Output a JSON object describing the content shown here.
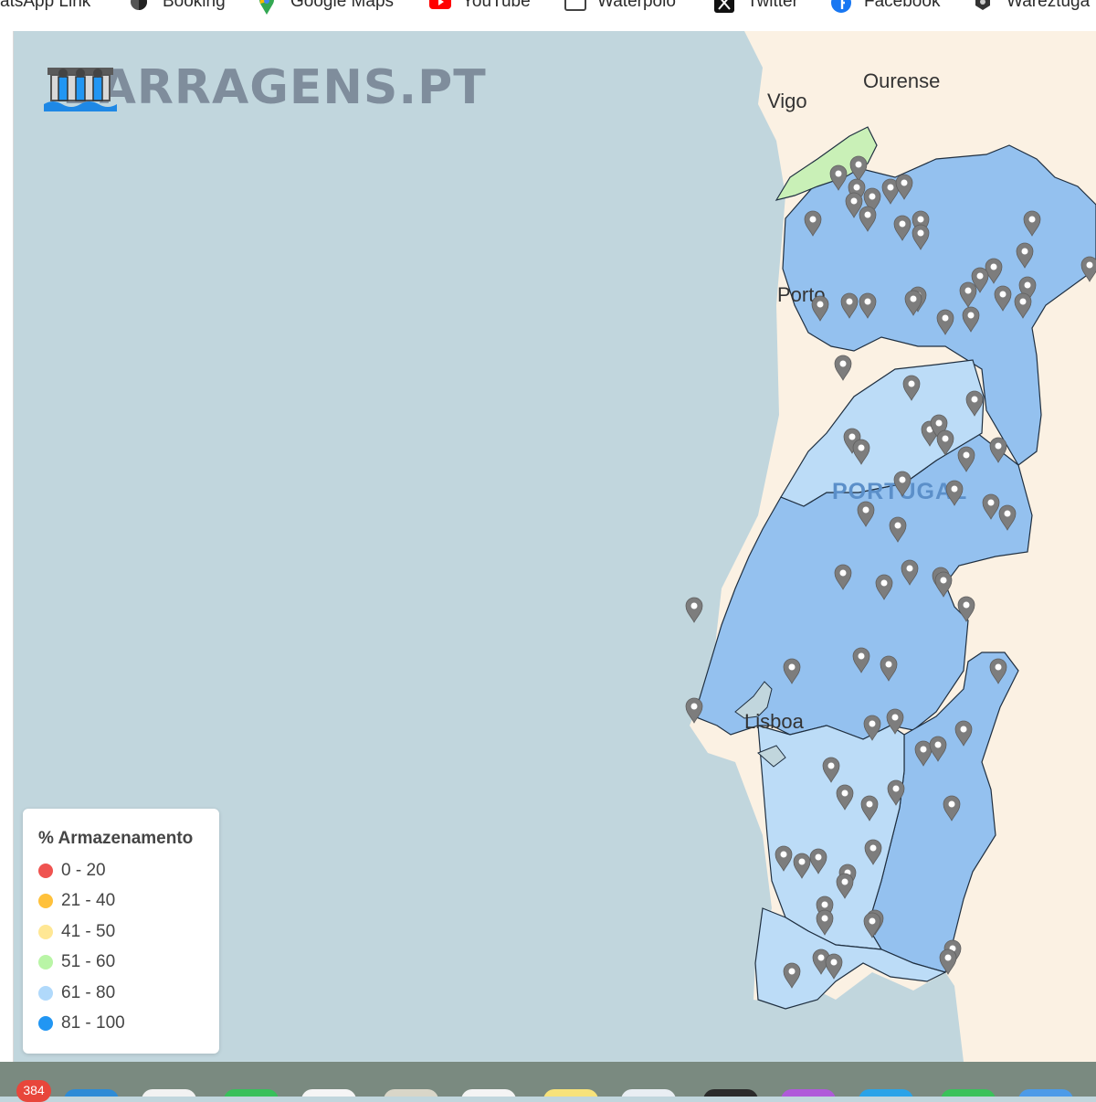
{
  "bookmarks": [
    {
      "label": "atsApp Link",
      "icon": "whatsapp-icon"
    },
    {
      "label": "Booking",
      "icon": "globe-icon"
    },
    {
      "label": "Google Maps",
      "icon": "google-maps-icon"
    },
    {
      "label": "YouTube",
      "icon": "youtube-icon"
    },
    {
      "label": "Waterpolo",
      "icon": "folder-icon"
    },
    {
      "label": "Twitter",
      "icon": "x-icon"
    },
    {
      "label": "Facebook",
      "icon": "facebook-icon"
    },
    {
      "label": "Wareztuga",
      "icon": "wareztuga-icon"
    }
  ],
  "site": {
    "title": "BARRAGENS.PT",
    "logo_icon": "dam-icon"
  },
  "map": {
    "cities": {
      "vigo": "Vigo",
      "ourense": "Ourense",
      "porto": "Porto",
      "lisboa": "Lisboa"
    },
    "country": "PORTUGAL",
    "colors": {
      "sea": "#c1d6dd",
      "land": "#fbf1e3",
      "basin_81_100": "#94c1ef",
      "basin_61_80": "#bcdcf7",
      "basin_51_60": "#c9f0b7",
      "marker": "#7d7d7d"
    }
  },
  "legend": {
    "title": "% Armazenamento",
    "items": [
      {
        "label": "0 - 20",
        "color": "#ef5350"
      },
      {
        "label": "21 - 40",
        "color": "#ffc13b"
      },
      {
        "label": "41 - 50",
        "color": "#ffe794"
      },
      {
        "label": "51 - 60",
        "color": "#b9f5a6"
      },
      {
        "label": "61 - 80",
        "color": "#b0d9fb"
      },
      {
        "label": "81 - 100",
        "color": "#2196f3"
      }
    ]
  },
  "dock": {
    "badge": "384"
  }
}
